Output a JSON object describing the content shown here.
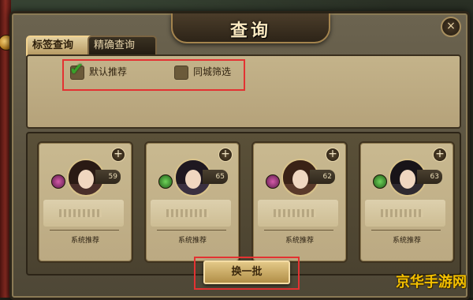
{
  "window": {
    "title": "查询",
    "close_label": "×"
  },
  "tabs": [
    {
      "label": "标签查询",
      "active": true
    },
    {
      "label": "精确查询",
      "active": false
    }
  ],
  "filters": [
    {
      "label": "默认推荐",
      "checked": true
    },
    {
      "label": "同城筛选",
      "checked": false
    }
  ],
  "cards": [
    {
      "level": "59",
      "caption": "系统推荐",
      "add_label": "+"
    },
    {
      "level": "65",
      "caption": "系统推荐",
      "add_label": "+"
    },
    {
      "level": "62",
      "caption": "系统推荐",
      "add_label": "+"
    },
    {
      "level": "63",
      "caption": "系统推荐",
      "add_label": "+"
    }
  ],
  "refresh_button": {
    "label": "换一批"
  },
  "watermark": "京华手游网",
  "colors": {
    "highlight_red": "#e33232",
    "checkbox_green": "#3aa02a",
    "watermark_yellow": "#f4c000"
  }
}
